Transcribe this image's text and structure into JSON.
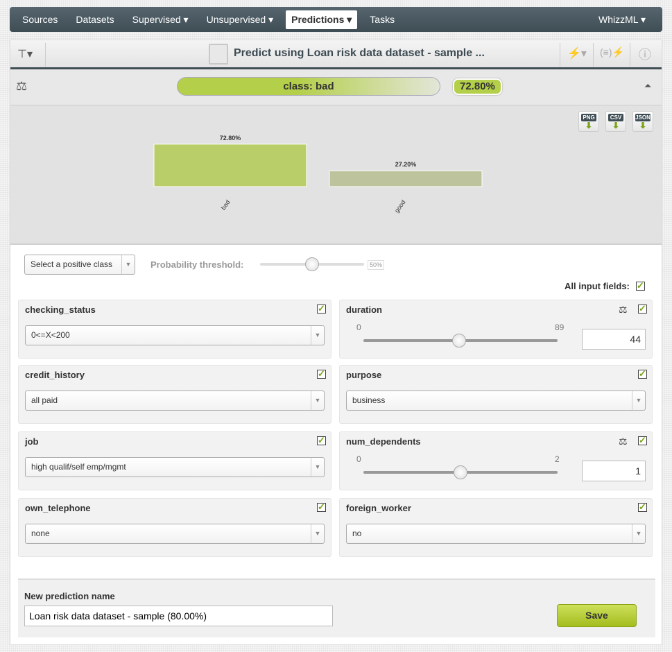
{
  "nav": {
    "items": [
      "Sources",
      "Datasets",
      "Supervised ▾",
      "Unsupervised ▾",
      "Predictions ▾",
      "Tasks"
    ],
    "active": 4,
    "right": "WhizzML ▾"
  },
  "header": {
    "title": "Predict using Loan risk data dataset - sample ..."
  },
  "prediction": {
    "label": "class: bad",
    "confidence": "72.80%"
  },
  "downloads": [
    "PNG",
    "CSV",
    "JSON"
  ],
  "chart_data": {
    "type": "bar",
    "categories": [
      "bad",
      "good"
    ],
    "values": [
      72.8,
      27.2
    ],
    "value_labels": [
      "72.80%",
      "27.20%"
    ],
    "colors": [
      "#b9cd68",
      "#bdc49d"
    ],
    "ylim": [
      0,
      100
    ]
  },
  "controls": {
    "positive_class_placeholder": "Select a positive class",
    "threshold_label": "Probability threshold:",
    "threshold_value": "50%",
    "threshold": 0.5,
    "all_fields_label": "All input fields:"
  },
  "fields": [
    {
      "name": "checking_status",
      "type": "select",
      "value": "0<=X<200"
    },
    {
      "name": "duration",
      "type": "numeric",
      "min": "0",
      "max": "89",
      "value": "44"
    },
    {
      "name": "credit_history",
      "type": "select",
      "value": "all paid"
    },
    {
      "name": "purpose",
      "type": "select",
      "value": "business"
    },
    {
      "name": "job",
      "type": "select",
      "value": "high qualif/self emp/mgmt"
    },
    {
      "name": "num_dependents",
      "type": "numeric",
      "min": "0",
      "max": "2",
      "value": "1"
    },
    {
      "name": "own_telephone",
      "type": "select",
      "value": "none"
    },
    {
      "name": "foreign_worker",
      "type": "select",
      "value": "no"
    }
  ],
  "footer": {
    "name_label": "New prediction name",
    "name_value": "Loan risk data dataset - sample (80.00%)",
    "save_label": "Save"
  }
}
